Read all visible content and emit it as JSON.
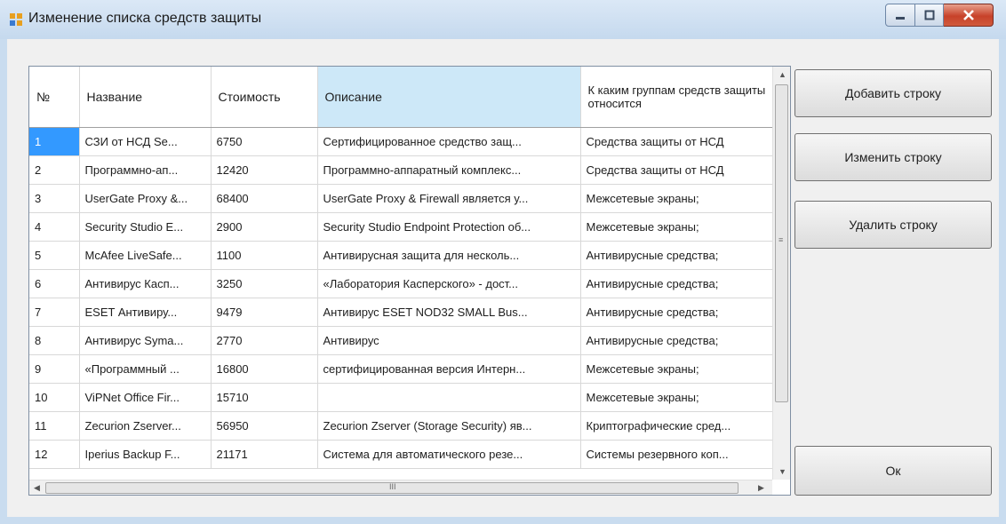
{
  "window": {
    "title": "Изменение списка средств защиты"
  },
  "table": {
    "columns": [
      "№",
      "Название",
      "Стоимость",
      "Описание",
      "К каким группам средств защиты относится"
    ],
    "rows": [
      [
        "1",
        "СЗИ от НСД Se...",
        "6750",
        "Сертифицированное средство защ...",
        "Средства защиты от НСД"
      ],
      [
        "2",
        "Программно-ап...",
        "12420",
        "Программно-аппаратный комплекс...",
        "Средства защиты от НСД"
      ],
      [
        "3",
        "UserGate Proxy &...",
        "68400",
        "UserGate Proxy & Firewall является у...",
        "Межсетевые экраны;"
      ],
      [
        "4",
        "Security Studio E...",
        "2900",
        "Security Studio Endpoint Protection об...",
        "Межсетевые экраны;"
      ],
      [
        "5",
        "McAfee LiveSafe...",
        "1100",
        "Антивирусная защита для несколь...",
        "Антивирусные средства;"
      ],
      [
        "6",
        "Антивирус Касп...",
        "3250",
        "«Лаборатория Касперского» - дост...",
        "Антивирусные средства;"
      ],
      [
        "7",
        "ESET Антивиру...",
        "9479",
        "Антивирус ESET NOD32 SMALL Bus...",
        "Антивирусные средства;"
      ],
      [
        "8",
        "Антивирус Syma...",
        "2770",
        "Антивирус",
        "Антивирусные средства;"
      ],
      [
        "9",
        "«Программный ...",
        "16800",
        "сертифицированная версия Интерн...",
        "Межсетевые экраны;"
      ],
      [
        "10",
        "ViPNet Office Fir...",
        "15710",
        "",
        "Межсетевые экраны;"
      ],
      [
        "11",
        "Zecurion Zserver...",
        "56950",
        "Zecurion Zserver (Storage Security) яв...",
        "Криптографические сред..."
      ],
      [
        "12",
        "Iperius Backup F...",
        "21171",
        "Система для автоматического резе...",
        "Системы резервного коп..."
      ]
    ]
  },
  "buttons": {
    "add": "Добавить строку",
    "edit": "Изменить строку",
    "delete": "Удалить строку",
    "ok": "Ок"
  },
  "scroll": {
    "grip": "≡",
    "hgrip": "III"
  }
}
